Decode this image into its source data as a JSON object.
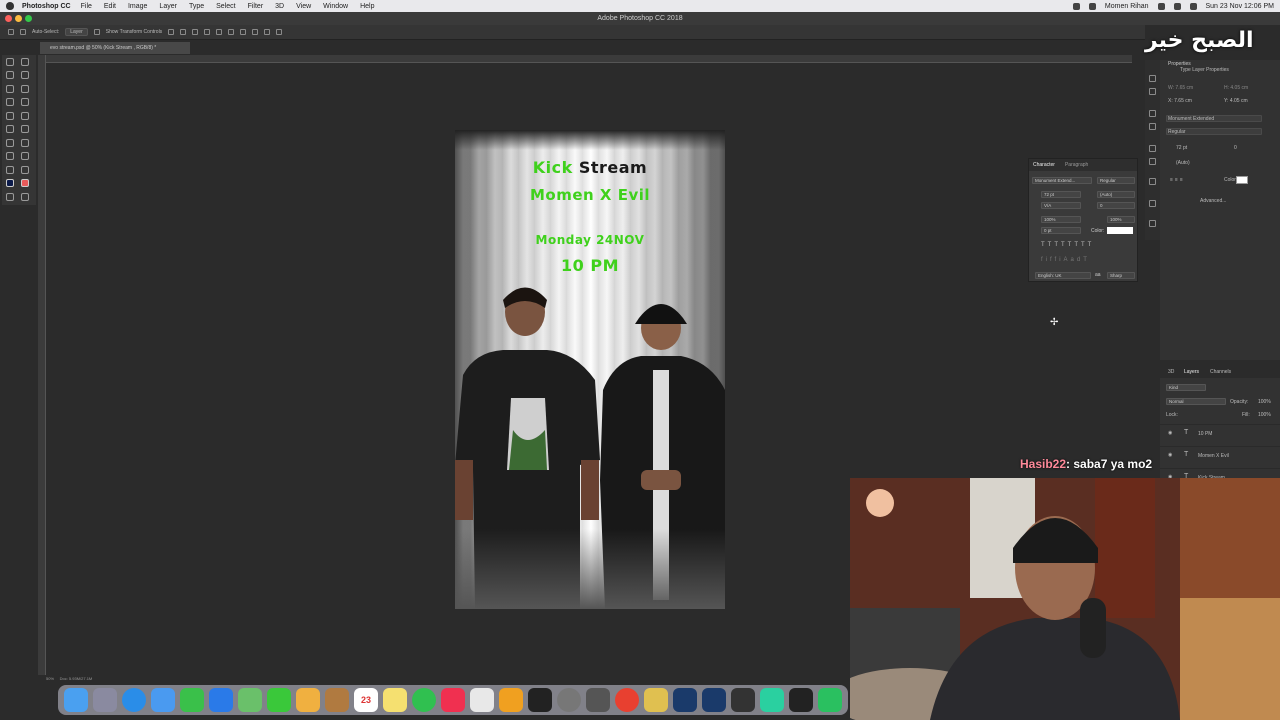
{
  "menubar": {
    "app_name": "Photoshop CC",
    "items": [
      "File",
      "Edit",
      "Image",
      "Layer",
      "Type",
      "Select",
      "Filter",
      "3D",
      "View",
      "Window",
      "Help"
    ],
    "user": "Momen Rihan",
    "datetime": "Sun 23 Nov 12:06 PM"
  },
  "window": {
    "title": "Adobe Photoshop CC 2018",
    "doc_tab": "evo stream.psd @ 50% (Kick Stream , RGB/8) *"
  },
  "options": {
    "auto_select_label": "Auto-Select:",
    "auto_select_value": "Layer",
    "transform_label": "Show Transform Controls"
  },
  "poster": {
    "line1_a": "Kick",
    "line1_b": "Stream",
    "line2": "Momen X Evil",
    "line3": "Monday 24NOV",
    "line4": "10 PM",
    "green": "#3fd11c",
    "dark": "#1a1a1a"
  },
  "properties": {
    "title": "Properties",
    "section": "Type Layer Properties",
    "w": "W: 7.65 cm",
    "h": "H: 4.05 cm",
    "x": "X: 7.65 cm",
    "y": "Y: 4.05 cm",
    "font": "Monument Extended",
    "style": "Regular",
    "size": "72 pt",
    "tracking": "0",
    "leading": "(Auto)",
    "color_label": "Color:",
    "advanced": "Advanced..."
  },
  "character": {
    "tab1": "Character",
    "tab2": "Paragraph",
    "font": "Monument Extend...",
    "style": "Regular",
    "size": "72 pt",
    "leading": "(Auto)",
    "kerning": "V/A",
    "tracking": "0",
    "vscale": "100%",
    "hscale": "100%",
    "baseline": "0 pt",
    "color_label": "Color:",
    "language": "English: UK",
    "aa_icon": "aa",
    "antialias": "Sharp"
  },
  "layers": {
    "tab_3d": "3D",
    "tab_layers": "Layers",
    "tab_channels": "Channels",
    "kind": "Kind",
    "blend": "Normal",
    "opacity_label": "Opacity:",
    "opacity": "100%",
    "lock_label": "Lock:",
    "fill_label": "Fill:",
    "fill": "100%",
    "items": [
      "10 PM",
      "Momen X Evil",
      "Kick Stream"
    ]
  },
  "status": {
    "zoom": "50%",
    "doc": "Doc: 5.93M/27.1M"
  },
  "dock": {
    "calendar_day": "23"
  },
  "stream": {
    "chat_user": "Hasib22",
    "chat_message": ": saba7 ya mo2",
    "overlay_text": "الصبح خير"
  }
}
